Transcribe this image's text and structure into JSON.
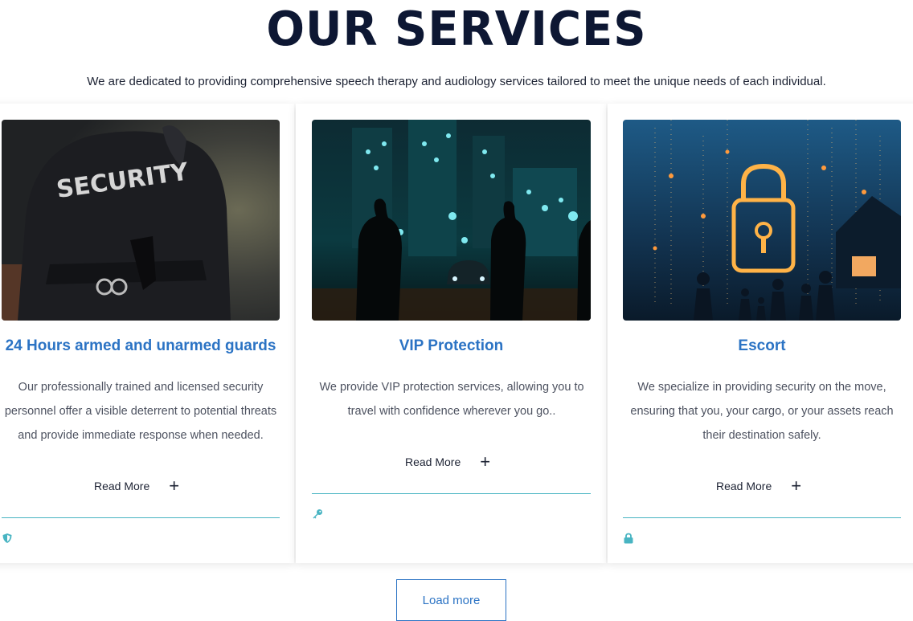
{
  "header": {
    "title": "OUR SERVICES",
    "subtitle": "We are dedicated to providing comprehensive speech therapy and audiology services tailored to meet the unique needs of each individual."
  },
  "cards": [
    {
      "title": "24 Hours armed and unarmed guards",
      "description": "Our professionally trained and licensed security personnel offer a visible deterrent to potential threats and provide immediate response when needed.",
      "read_more": "Read More",
      "image_text": "SECURITY",
      "icon": "shield-icon"
    },
    {
      "title": "VIP Protection",
      "description": "We provide VIP protection services, allowing you to travel with confidence wherever you go..",
      "read_more": "Read More",
      "icon": "key-icon"
    },
    {
      "title": "Escort",
      "description": "We specialize in providing security on the move, ensuring that you, your cargo, or your assets reach their destination safely.",
      "read_more": "Read More",
      "icon": "lock-icon"
    }
  ],
  "load_more": "Load more",
  "colors": {
    "title": "#0d1733",
    "accent": "#2b73c4",
    "teal": "#48b4c2"
  }
}
